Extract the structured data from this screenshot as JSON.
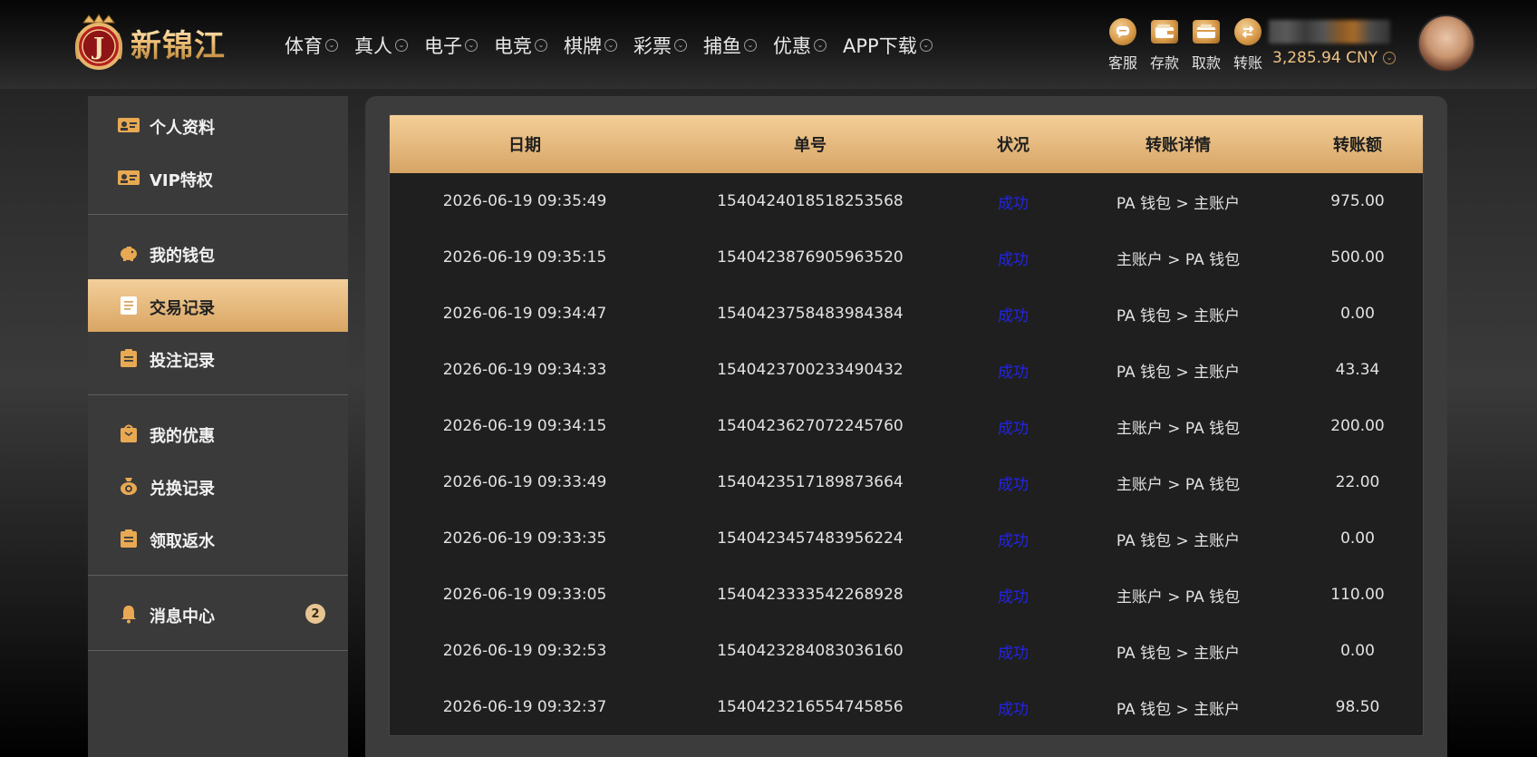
{
  "brand": {
    "name": "新锦江",
    "badge_letter": "J"
  },
  "nav": [
    {
      "label": "体育"
    },
    {
      "label": "真人"
    },
    {
      "label": "电子"
    },
    {
      "label": "电竞"
    },
    {
      "label": "棋牌"
    },
    {
      "label": "彩票"
    },
    {
      "label": "捕鱼"
    },
    {
      "label": "优惠"
    },
    {
      "label": "APP下载"
    }
  ],
  "actions": [
    {
      "label": "客服",
      "icon": "chat-icon"
    },
    {
      "label": "存款",
      "icon": "deposit-wallet-icon"
    },
    {
      "label": "取款",
      "icon": "withdraw-wallet-icon"
    },
    {
      "label": "转账",
      "icon": "transfer-icon"
    }
  ],
  "balance": "3,285.94 CNY",
  "sidebar": {
    "items": [
      {
        "label": "个人资料",
        "icon": "id-card-icon"
      },
      {
        "label": "VIP特权",
        "icon": "vip-card-icon"
      },
      {
        "label": "我的钱包",
        "icon": "piggy-bank-icon"
      },
      {
        "label": "交易记录",
        "icon": "document-icon",
        "active": true
      },
      {
        "label": "投注记录",
        "icon": "clipboard-icon"
      },
      {
        "label": "我的优惠",
        "icon": "gift-bag-icon"
      },
      {
        "label": "兑换记录",
        "icon": "money-bag-icon"
      },
      {
        "label": "领取返水",
        "icon": "clipboard-icon"
      },
      {
        "label": "消息中心",
        "icon": "bell-icon",
        "badge": "2"
      }
    ]
  },
  "table": {
    "headers": [
      "日期",
      "单号",
      "状况",
      "转账详情",
      "转账额"
    ],
    "rows": [
      [
        "2026-06-19 09:35:49",
        "1540424018518253568",
        "成功",
        "PA 钱包 > 主账户",
        "975.00"
      ],
      [
        "2026-06-19 09:35:15",
        "1540423876905963520",
        "成功",
        "主账户 > PA 钱包",
        "500.00"
      ],
      [
        "2026-06-19 09:34:47",
        "1540423758483984384",
        "成功",
        "PA 钱包 > 主账户",
        "0.00"
      ],
      [
        "2026-06-19 09:34:33",
        "1540423700233490432",
        "成功",
        "PA 钱包 > 主账户",
        "43.34"
      ],
      [
        "2026-06-19 09:34:15",
        "1540423627072245760",
        "成功",
        "主账户 > PA 钱包",
        "200.00"
      ],
      [
        "2026-06-19 09:33:49",
        "1540423517189873664",
        "成功",
        "主账户 > PA 钱包",
        "22.00"
      ],
      [
        "2026-06-19 09:33:35",
        "1540423457483956224",
        "成功",
        "PA 钱包 > 主账户",
        "0.00"
      ],
      [
        "2026-06-19 09:33:05",
        "1540423333542268928",
        "成功",
        "主账户 > PA 钱包",
        "110.00"
      ],
      [
        "2026-06-19 09:32:53",
        "1540423284083036160",
        "成功",
        "PA 钱包 > 主账户",
        "0.00"
      ],
      [
        "2026-06-19 09:32:37",
        "1540423216554745856",
        "成功",
        "PA 钱包 > 主账户",
        "98.50"
      ]
    ]
  },
  "colors": {
    "gold": "#e0ad68",
    "status_success": "#2323e6"
  }
}
